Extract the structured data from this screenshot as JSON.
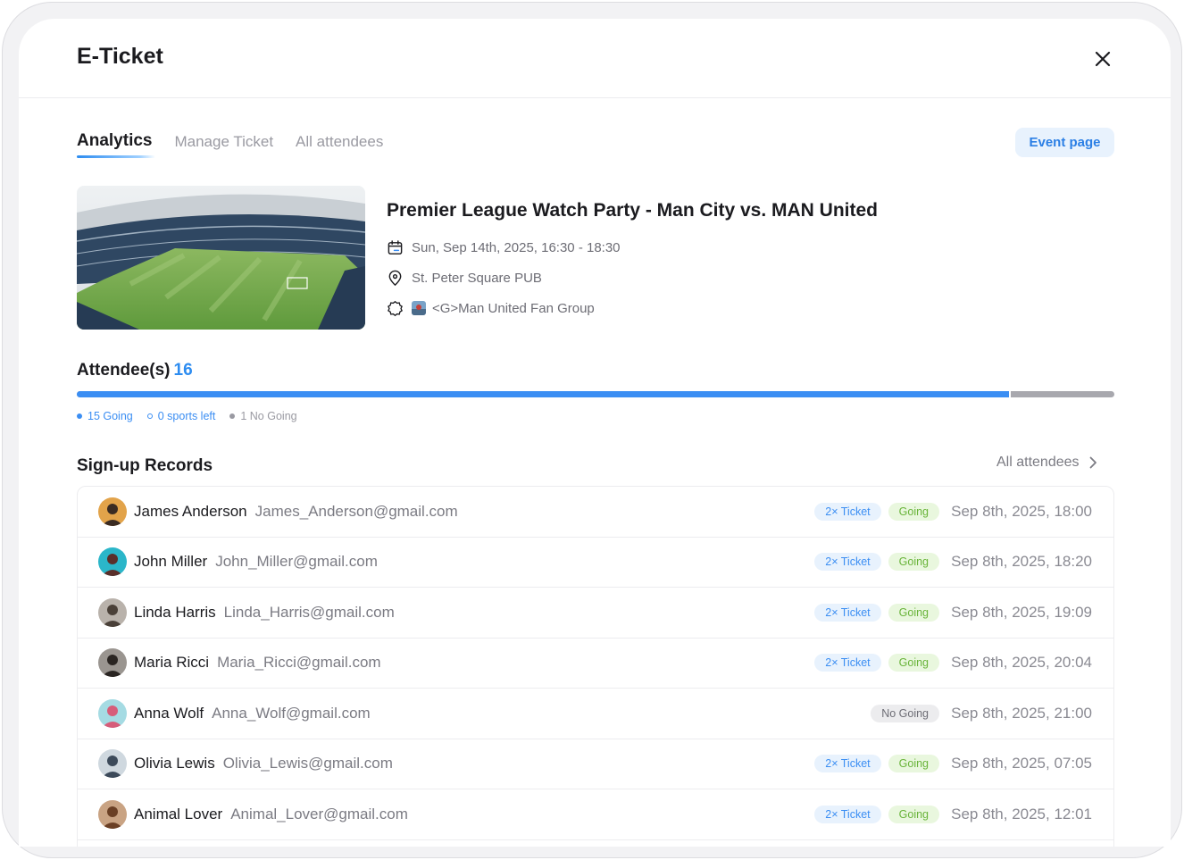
{
  "header": {
    "title": "E-Ticket"
  },
  "tabs": [
    {
      "label": "Analytics",
      "active": true
    },
    {
      "label": "Manage Ticket",
      "active": false
    },
    {
      "label": "All attendees",
      "active": false
    }
  ],
  "event_button": "Event page",
  "event": {
    "title": "Premier League Watch Party - Man City vs. MAN United",
    "datetime": "Sun, Sep 14th, 2025, 16:30 - 18:30",
    "location": "St. Peter Square PUB",
    "group": "<G>Man United Fan Group"
  },
  "attendees": {
    "label": "Attendee(s)",
    "count": "16",
    "going_fraction": 0.9,
    "legend": {
      "going": "15 Going",
      "spots_left": "0 sports left",
      "no_going": "1 No Going"
    }
  },
  "records": {
    "title": "Sign-up Records",
    "all_link": "All attendees",
    "items": [
      {
        "name": "James Anderson",
        "email": "James_Anderson@gmail.com",
        "ticket": "2× Ticket",
        "status": "Going",
        "time": "Sep 8th, 2025, 18:00"
      },
      {
        "name": "John Miller",
        "email": "John_Miller@gmail.com",
        "ticket": "2× Ticket",
        "status": "Going",
        "time": "Sep 8th, 2025, 18:20"
      },
      {
        "name": "Linda Harris",
        "email": "Linda_Harris@gmail.com",
        "ticket": "2× Ticket",
        "status": "Going",
        "time": "Sep 8th, 2025, 19:09"
      },
      {
        "name": "Maria Ricci",
        "email": "Maria_Ricci@gmail.com",
        "ticket": "2× Ticket",
        "status": "Going",
        "time": "Sep 8th, 2025, 20:04"
      },
      {
        "name": "Anna Wolf",
        "email": "Anna_Wolf@gmail.com",
        "ticket": "",
        "status": "No Going",
        "time": "Sep 8th, 2025, 21:00"
      },
      {
        "name": "Olivia Lewis",
        "email": "Olivia_Lewis@gmail.com",
        "ticket": "2× Ticket",
        "status": "Going",
        "time": "Sep 8th, 2025, 07:05"
      },
      {
        "name": "Animal Lover",
        "email": "Animal_Lover@gmail.com",
        "ticket": "2× Ticket",
        "status": "Going",
        "time": "Sep 8th, 2025, 12:01"
      }
    ]
  },
  "colors": {
    "accent": "#3b8ef3",
    "going_green": "#69b43a",
    "muted": "#a8a8ae"
  },
  "icons": {
    "close": "close-icon",
    "calendar": "calendar-icon",
    "location": "location-pin-icon",
    "group": "group-badge-icon",
    "chevron": "chevron-right-icon"
  }
}
